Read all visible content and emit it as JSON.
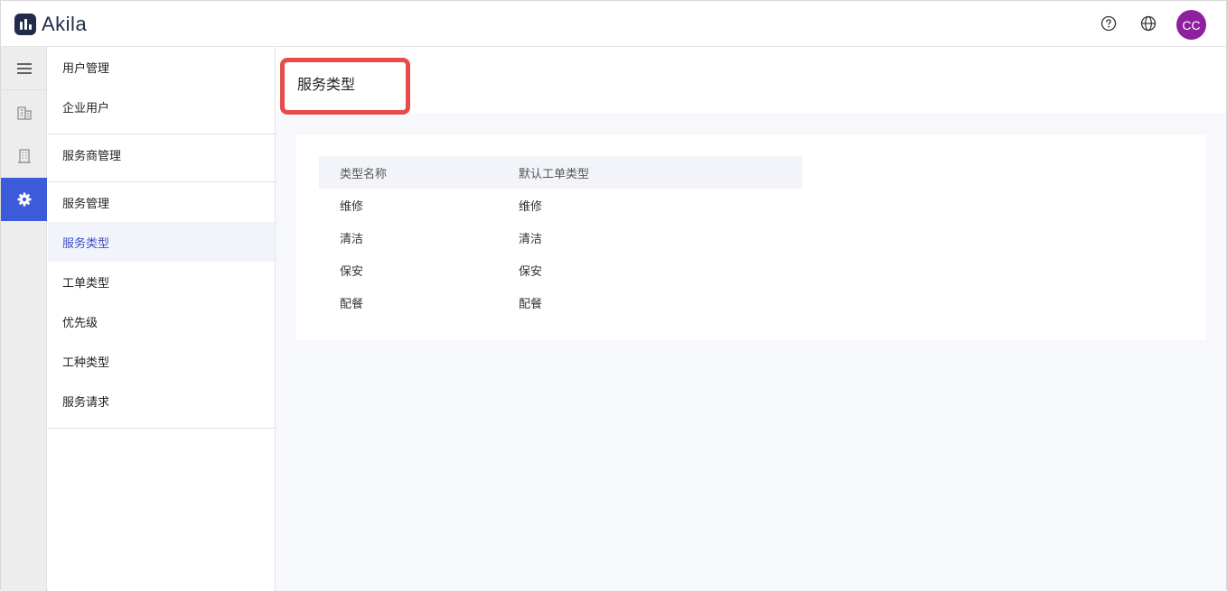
{
  "app": {
    "name": "Akila"
  },
  "header": {
    "avatar_initials": "CC",
    "avatar_color": "#8e1f9e"
  },
  "rail": {
    "icons": [
      "menu-icon",
      "building-icon",
      "office-building-icon",
      "gear-icon"
    ],
    "active_color": "#3b5bdb"
  },
  "sidebar": {
    "groups": [
      {
        "title": "用户管理",
        "items": [
          "企业用户"
        ]
      },
      {
        "title": "服务商管理",
        "items": []
      },
      {
        "title": "服务管理",
        "items": [
          "服务类型",
          "工单类型",
          "优先级",
          "工种类型",
          "服务请求"
        ]
      }
    ],
    "active_item": "服务类型"
  },
  "main": {
    "title": "服务类型",
    "table": {
      "columns": [
        "类型名称",
        "默认工单类型"
      ],
      "rows": [
        [
          "维修",
          "维修"
        ],
        [
          "清洁",
          "清洁"
        ],
        [
          "保安",
          "保安"
        ],
        [
          "配餐",
          "配餐"
        ]
      ]
    }
  }
}
